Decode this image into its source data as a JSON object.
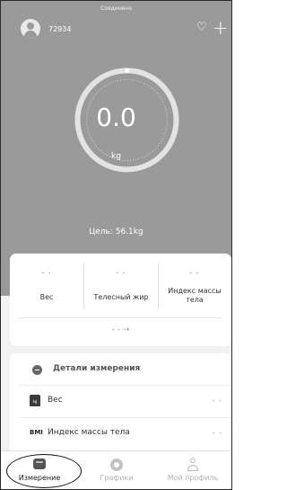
{
  "status": "Соединено",
  "user": {
    "id": "72934"
  },
  "gauge": {
    "value": "0.0",
    "unit": "kg"
  },
  "goal": "Цель: 56.1kg",
  "stats": {
    "items": [
      {
        "value": "- -",
        "label": "Вес"
      },
      {
        "value": "- -",
        "label": "Телесный жир"
      },
      {
        "value": "- -",
        "label": "Индекс массы тела"
      }
    ],
    "more": "- - →"
  },
  "details": {
    "title": "Детали измерения",
    "rows": [
      {
        "icon": "scale-kg-icon",
        "label": "Вес",
        "value": "- -"
      },
      {
        "icon": "bmi-icon",
        "icon_text": "BMI",
        "label": "Индекс массы тела",
        "value": "- -"
      }
    ]
  },
  "tabs": [
    {
      "label": "Измерение",
      "active": true
    },
    {
      "label": "Графики",
      "active": false
    },
    {
      "label": "Мой профиль",
      "active": false
    }
  ],
  "icons": {
    "scale_text": "kg"
  },
  "colors": {
    "hero": "#9a9a9a",
    "background": "#f2f2f2",
    "card": "#ffffff",
    "inactive_tab": "#b2b2b2"
  }
}
